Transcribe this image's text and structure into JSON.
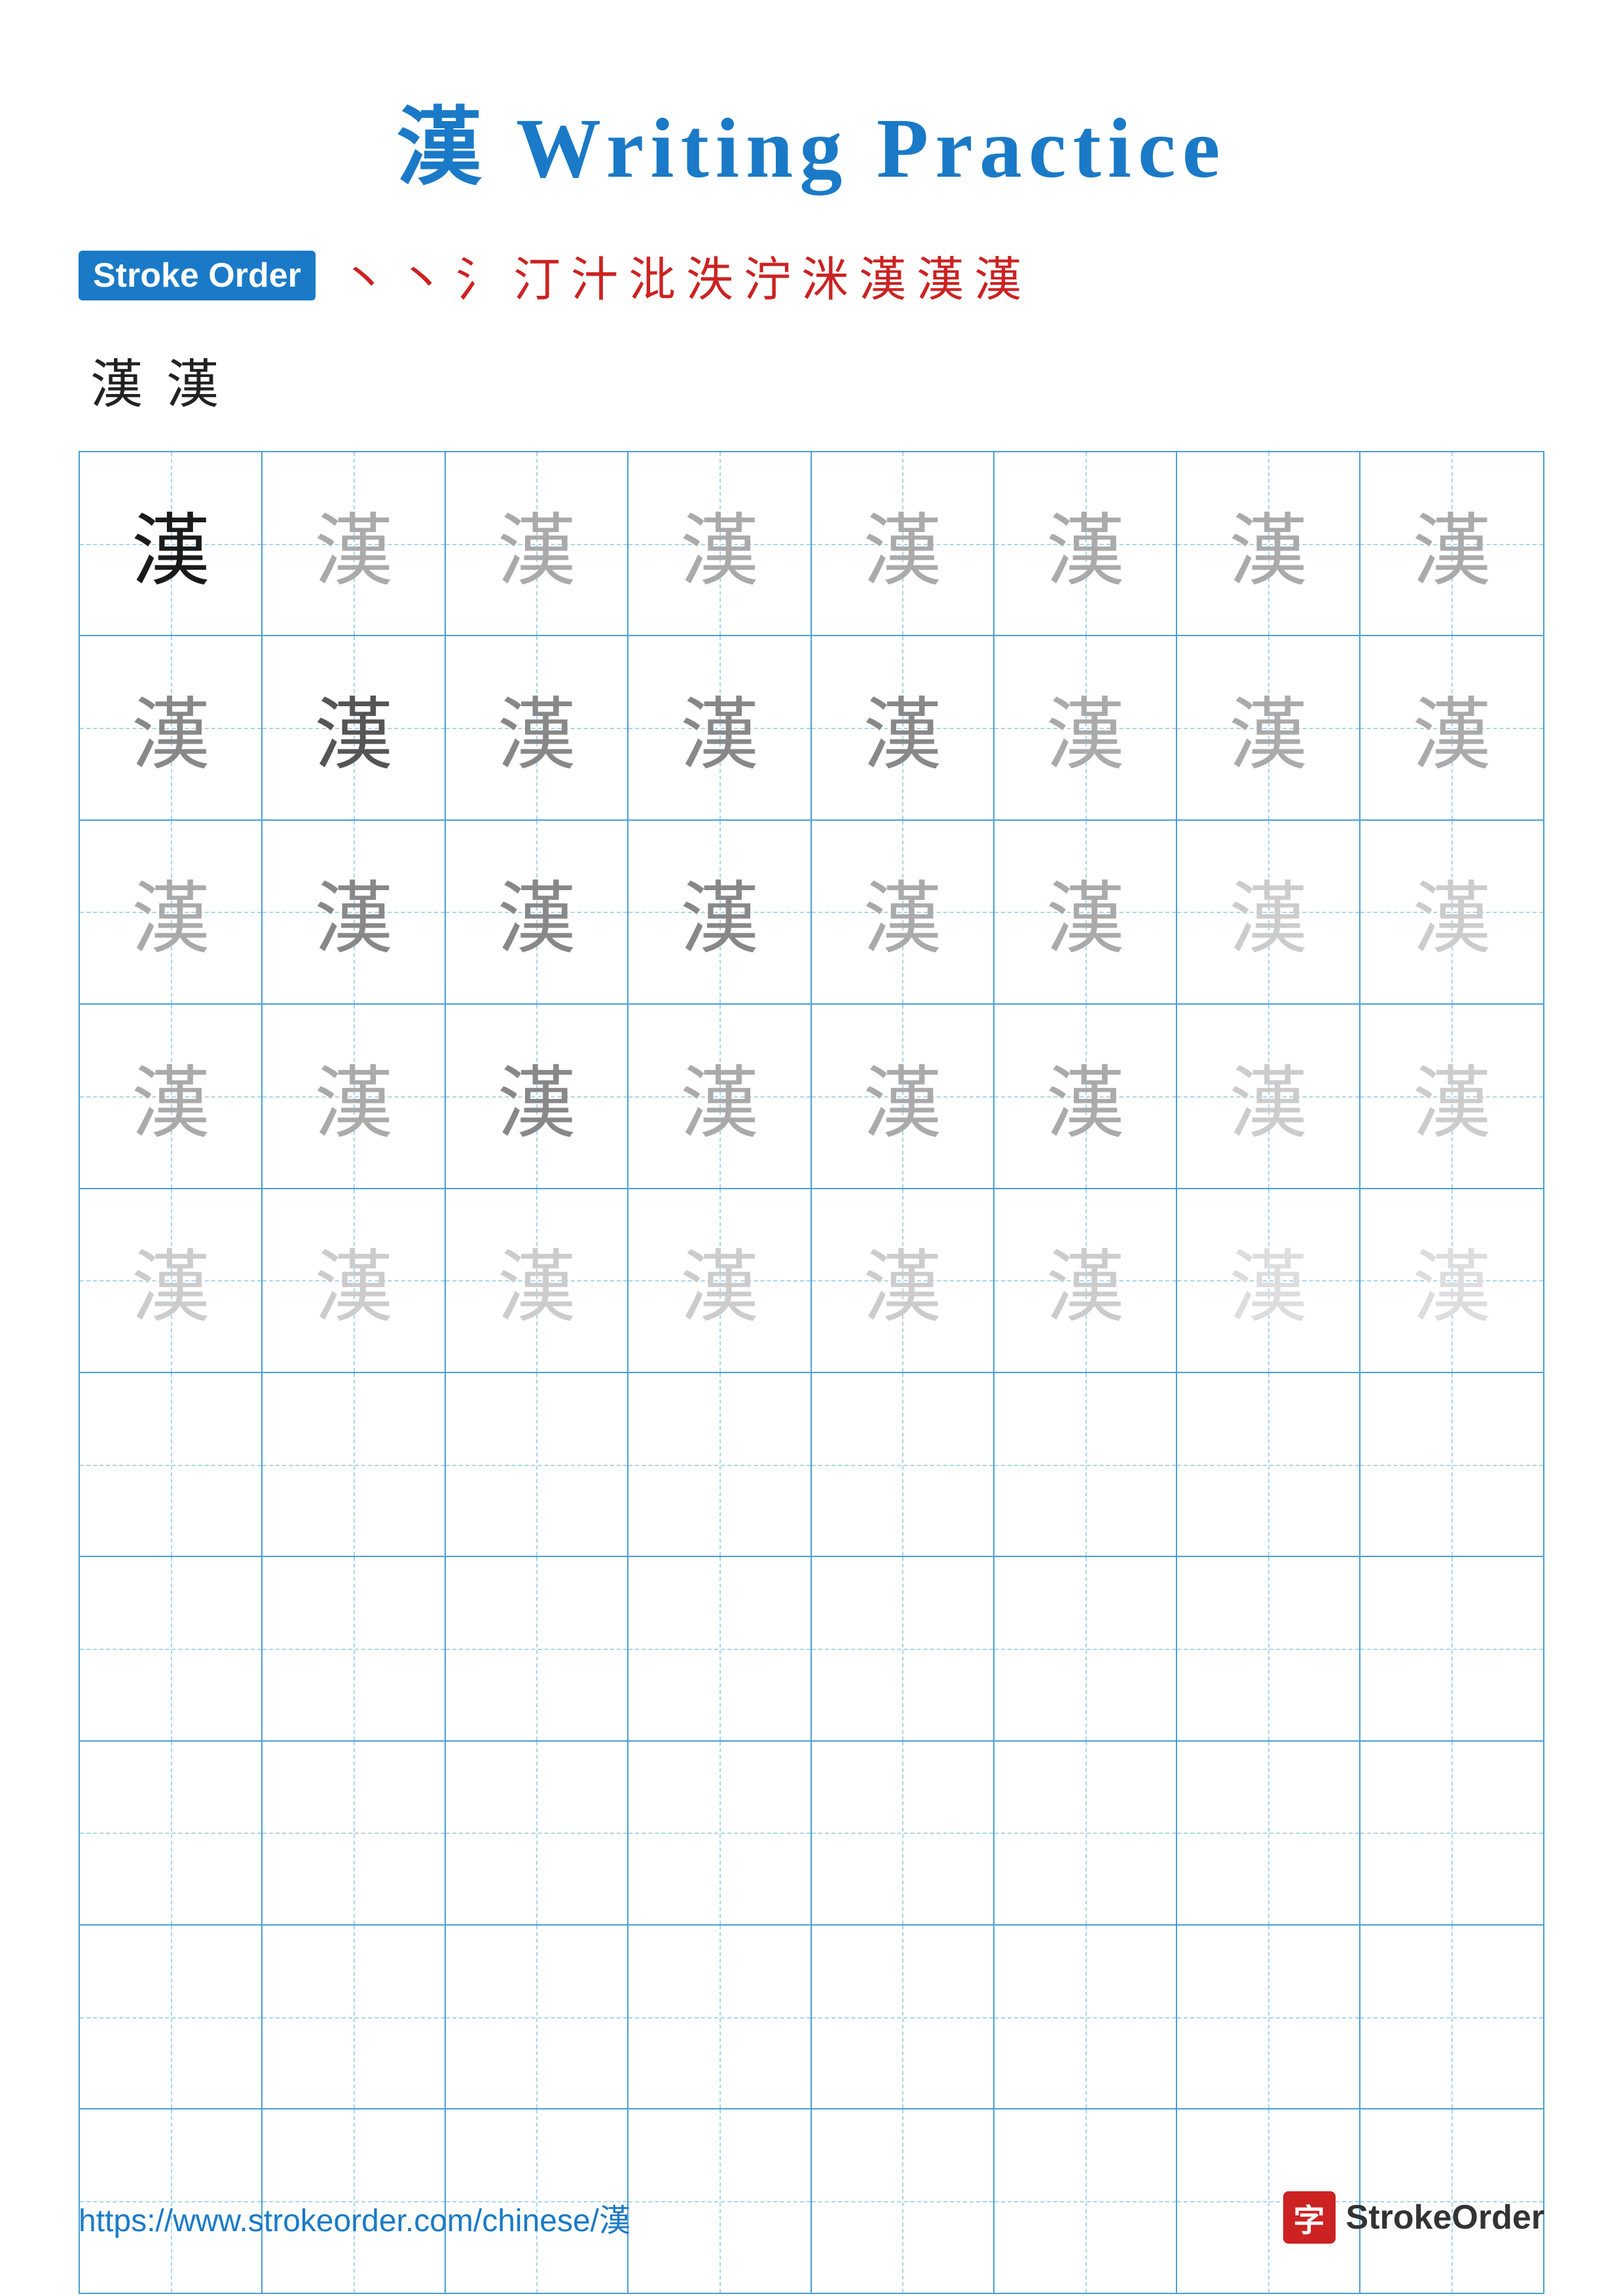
{
  "title": {
    "char": "漢",
    "label": "Writing Practice",
    "full": "漢 Writing Practice"
  },
  "stroke_order": {
    "badge_label": "Stroke Order",
    "strokes": [
      "丶",
      "丶",
      "氵",
      "汀",
      "汁",
      "泛",
      "泝",
      "泞",
      "泯",
      "漾",
      "漢",
      "漢"
    ],
    "preview_chars": [
      "漢",
      "漢"
    ]
  },
  "grid": {
    "rows": 10,
    "cols": 8,
    "char": "漢",
    "filled_rows": 5,
    "practice_rows": 5
  },
  "footer": {
    "url": "https://www.strokeorder.com/chinese/漢",
    "logo_char": "字",
    "logo_text": "StrokeOrder"
  }
}
